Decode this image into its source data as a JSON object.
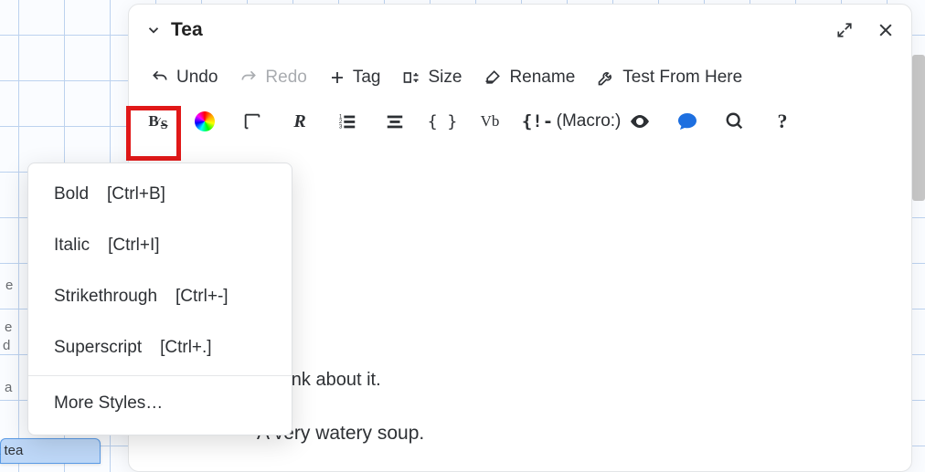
{
  "title": "Tea",
  "toolbar": {
    "undo": "Undo",
    "redo": "Redo",
    "tag": "Tag",
    "size": "Size",
    "rename": "Rename",
    "test": "Test From Here"
  },
  "toolbar2": {
    "macro": "(Macro:)"
  },
  "menu": {
    "bold": {
      "label": "Bold",
      "shortcut": "[Ctrl+B]"
    },
    "italic": {
      "label": "Italic",
      "shortcut": "[Ctrl+I]"
    },
    "strike": {
      "label": "Strikethrough",
      "shortcut": "[Ctrl+-]"
    },
    "superscript": {
      "label": "Superscript",
      "shortcut": "[Ctrl+.]"
    },
    "more": {
      "label": "More Styles…"
    }
  },
  "body": {
    "line1": "u think about it.",
    "line2": "A very watery soup."
  },
  "bg": {
    "t1": "e",
    "t2": "e",
    "t3": "d",
    "t4": "a",
    "card": "rmint tea"
  }
}
